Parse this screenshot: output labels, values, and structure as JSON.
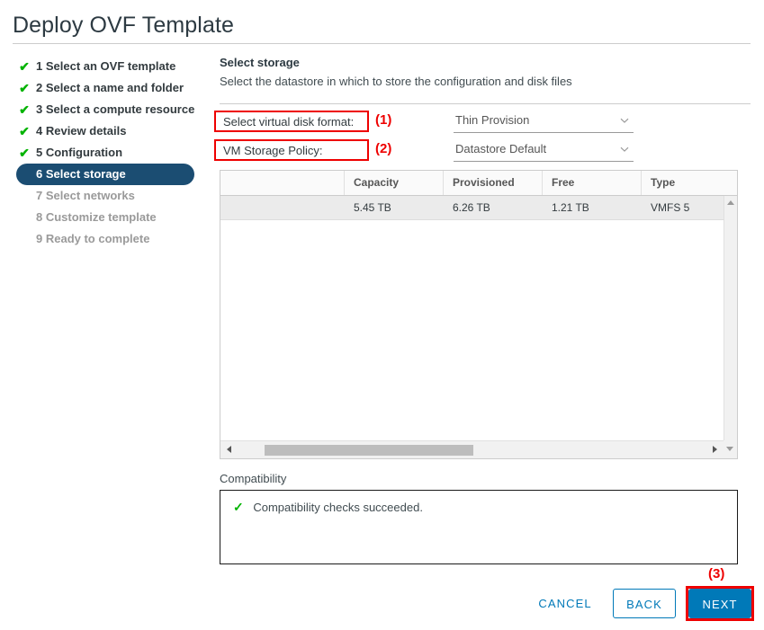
{
  "window": {
    "title": "Deploy OVF Template"
  },
  "sidebar": {
    "items": [
      {
        "label": "1 Select an OVF template",
        "state": "done",
        "check": "✔"
      },
      {
        "label": "2 Select a name and folder",
        "state": "done",
        "check": "✔"
      },
      {
        "label": "3 Select a compute resource",
        "state": "done",
        "check": "✔"
      },
      {
        "label": "4 Review details",
        "state": "done",
        "check": "✔"
      },
      {
        "label": "5 Configuration",
        "state": "done",
        "check": "✔"
      },
      {
        "label": "6 Select storage",
        "state": "current",
        "check": ""
      },
      {
        "label": "7 Select networks",
        "state": "pending",
        "check": ""
      },
      {
        "label": "8 Customize template",
        "state": "pending",
        "check": ""
      },
      {
        "label": "9 Ready to complete",
        "state": "pending",
        "check": ""
      }
    ]
  },
  "pane": {
    "title": "Select storage",
    "subtitle": "Select the datastore in which to store the configuration and disk files"
  },
  "form": {
    "disk_format": {
      "label": "Select virtual disk format:",
      "value": "Thin Provision",
      "annotation": "(1)"
    },
    "storage_policy": {
      "label": "VM Storage Policy:",
      "value": "Datastore Default",
      "annotation": "(2)"
    }
  },
  "table": {
    "columns": [
      "",
      "Capacity",
      "Provisioned",
      "Free",
      "Type"
    ],
    "rows": [
      {
        "name": "",
        "capacity": "5.45 TB",
        "provisioned": "6.26 TB",
        "free": "1.21 TB",
        "type": "VMFS 5"
      }
    ]
  },
  "compatibility": {
    "label": "Compatibility",
    "status_icon": "✓",
    "message": "Compatibility checks succeeded."
  },
  "footer": {
    "cancel_label": "CANCEL",
    "back_label": "BACK",
    "next_label": "NEXT",
    "next_annotation": "(3)"
  },
  "colors": {
    "accent_blue": "#0079b8",
    "selected_step": "#1b4d72",
    "annotation_red": "#ee0000",
    "success_green": "#00b300"
  }
}
